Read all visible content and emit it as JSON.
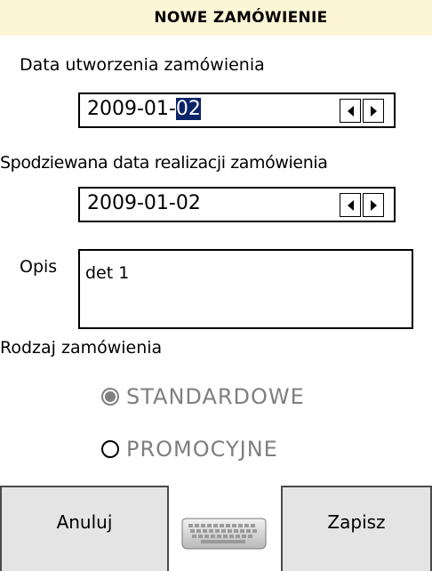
{
  "header": {
    "title": "NOWE ZAMÓWIENIE"
  },
  "form": {
    "created_date": {
      "label": "Data utworzenia zamówienia",
      "value_prefix": "2009-01-",
      "value_selected": "02"
    },
    "expected_date": {
      "label": "Spodziewana data realizacji zamówienia",
      "value": "2009-01-02"
    },
    "description": {
      "label": "Opis",
      "value": "det 1"
    },
    "order_type": {
      "label": "Rodzaj zamówienia",
      "options": [
        {
          "label": "STANDARDOWE",
          "checked": true,
          "enabled": false
        },
        {
          "label": "PROMOCYJNE",
          "checked": false,
          "enabled": false
        }
      ]
    }
  },
  "footer": {
    "cancel_label": "Anuluj",
    "save_label": "Zapisz",
    "keyboard_icon": "keyboard-icon"
  },
  "colors": {
    "header_bg": "#fdf6d6",
    "selection_bg": "#0a246a",
    "disabled_text": "#7f7f7f",
    "button_bg": "#e4e4e4"
  }
}
